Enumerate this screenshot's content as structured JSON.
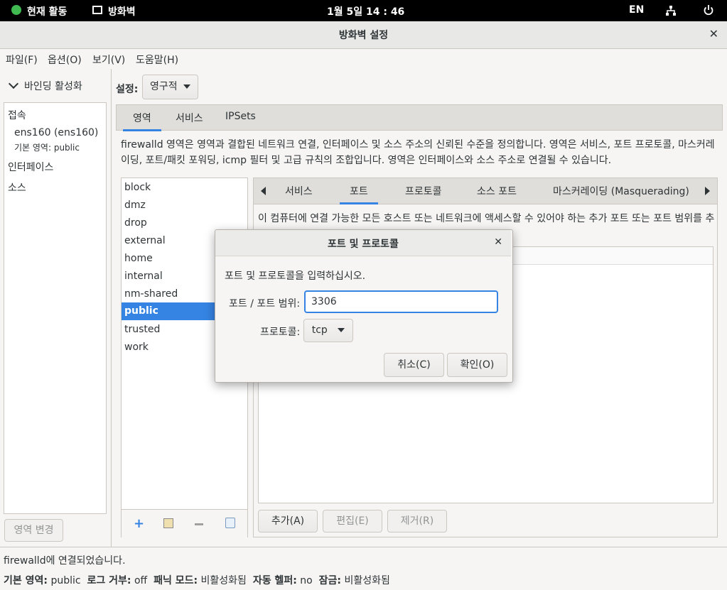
{
  "topbar": {
    "activities": "현재 활동",
    "app": "방화벽",
    "clock": "1월 5일  14 : 46",
    "lang": "EN"
  },
  "window": {
    "title": "방화벽 설정"
  },
  "menu": [
    "파일(F)",
    "옵션(O)",
    "보기(V)",
    "도움말(H)"
  ],
  "left": {
    "binding": "바인딩 활성화",
    "connections_header": "접속",
    "connection_name": "ens160 (ens160)",
    "connection_zone": "기본 영역: public",
    "interfaces_header": "인터페이스",
    "sources_header": "소스",
    "change_zone_button": "영역 변경"
  },
  "settings": {
    "label": "설정:",
    "mode": "영구적"
  },
  "tabs": [
    "영역",
    "서비스",
    "IPSets"
  ],
  "zone_description": "firewalld 영역은 영역과 결합된 네트워크 연결, 인터페이스 및 소스 주소의 신뢰된 수준을 정의합니다. 영역은 서비스, 포트 프로토콜, 마스커레이딩, 포트/패킷 포워딩, icmp 필터 및 고급 규칙의 조합입니다. 영역은 인터페이스와 소스 주소로 연결될 수 있습니다.",
  "zones": [
    "block",
    "dmz",
    "drop",
    "external",
    "home",
    "internal",
    "nm-shared",
    "public",
    "trusted",
    "work"
  ],
  "selected_zone": "public",
  "subtabs": [
    "서비스",
    "포트",
    "프로토콜",
    "소스 포트",
    "마스커레이딩 (Masquerading)"
  ],
  "port_description": "이 컴퓨터에 연결 가능한 모든 호스트 또는 네트워크에 액세스할 수 있어야 하는 추가 포트 또는 포트 범위를 추",
  "port_buttons": {
    "add": "추가(A)",
    "edit": "편집(E)",
    "remove": "제거(R)"
  },
  "status": {
    "connected": "firewalld에 연결되었습니다.",
    "default_zone_label": "기본 영역:",
    "default_zone": "public",
    "log_denied_label": "로그 거부:",
    "log_denied": "off",
    "panic_label": "패닉 모드:",
    "panic": "비활성화됨",
    "helpers_label": "자동 헬퍼:",
    "helpers": "no",
    "lockdown_label": "잠금:",
    "lockdown": "비활성화됨"
  },
  "dialog": {
    "title": "포트 및 프로토콜",
    "prompt": "포트 및 프로토콜을 입력하십시오.",
    "port_label": "포트 / 포트 범위:",
    "port_value": "3306",
    "protocol_label": "프로토콜:",
    "protocol_value": "tcp",
    "cancel": "취소(C)",
    "ok": "확인(O)"
  },
  "colors": {
    "accent": "#3584e4",
    "topbar": "#000000"
  }
}
